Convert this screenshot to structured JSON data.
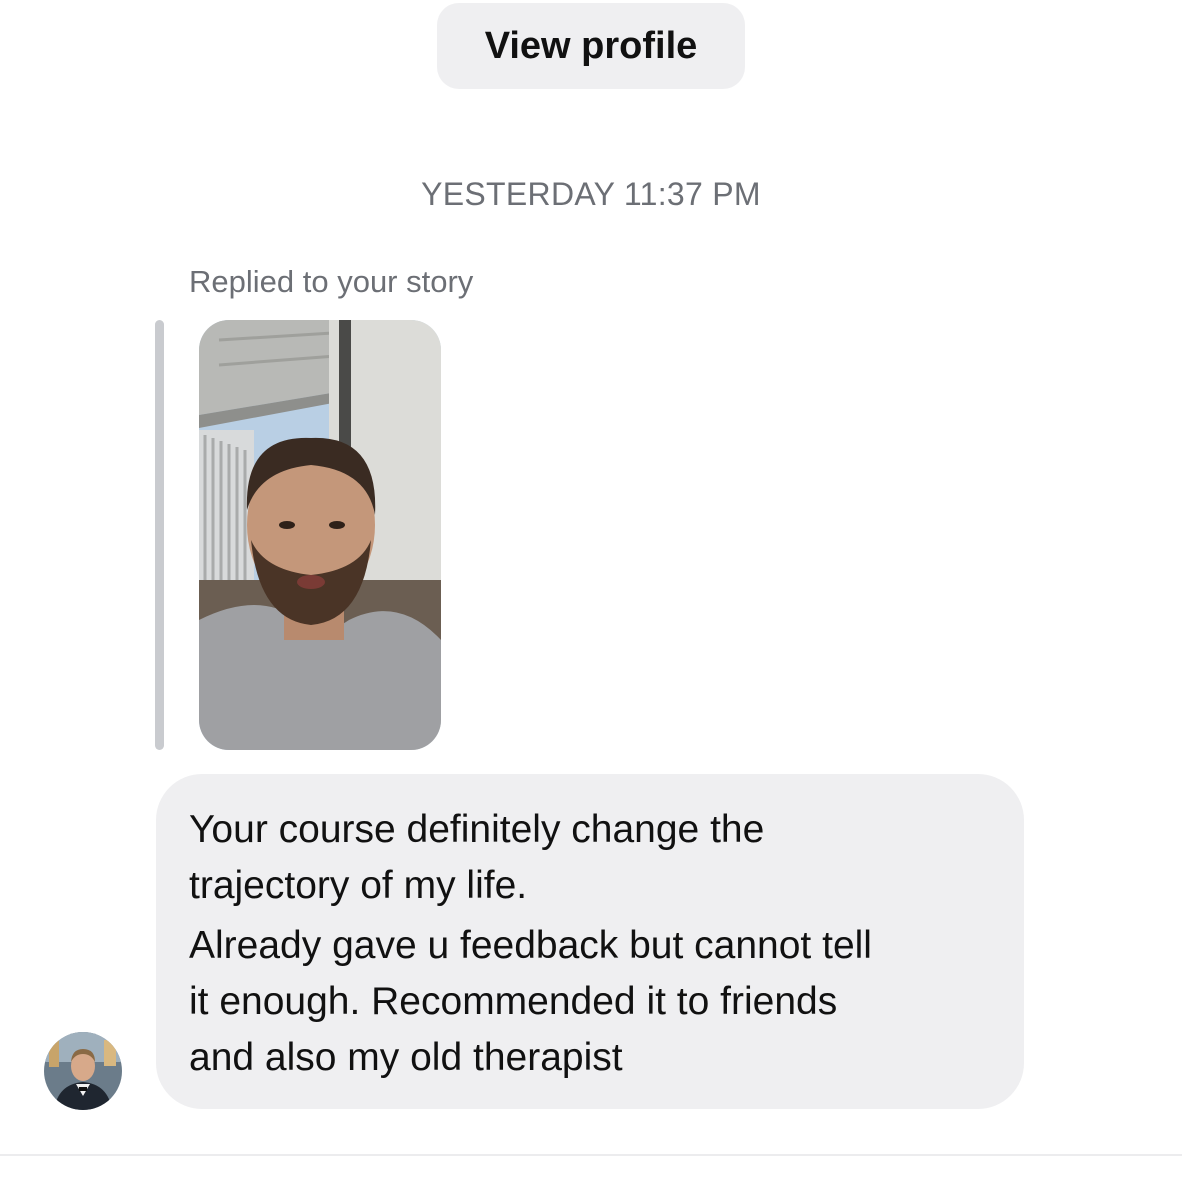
{
  "header": {
    "view_profile_label": "View profile"
  },
  "thread": {
    "timestamp": "YESTERDAY 11:37 PM",
    "reply_context": "Replied to your story",
    "message": {
      "lines": [
        "Your course definitely change the\ntrajectory of my life.",
        "Already gave u feedback but cannot tell\nit enough. Recommended it to friends\nand also my old therapist"
      ]
    }
  },
  "colors": {
    "bubble_background": "#efeff1",
    "secondary_text": "#6c6f75",
    "reply_bar": "#c9cbcf"
  }
}
